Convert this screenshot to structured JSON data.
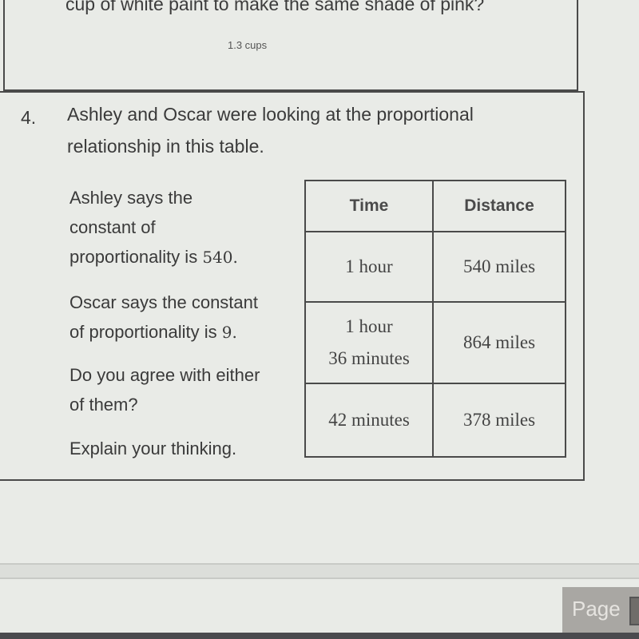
{
  "previous_question": {
    "text_fragment": "cup of white paint to make the same shade of pink?",
    "answer": "1.3 cups"
  },
  "question": {
    "number": "4.",
    "prompt_line1": "Ashley and Oscar were looking at the proportional",
    "prompt_line2": "relationship in this table.",
    "ashley_line1": "Ashley says the",
    "ashley_line2": "constant of",
    "ashley_line3": "proportionality is",
    "ashley_value": "540.",
    "oscar_line1": "Oscar says the constant",
    "oscar_line2": "of proportionality is",
    "oscar_value": "9.",
    "ask_line1": "Do you agree with either",
    "ask_line2": "of them?",
    "explain": "Explain your thinking."
  },
  "table": {
    "headers": [
      "Time",
      "Distance"
    ],
    "rows": [
      {
        "time": [
          "1 hour"
        ],
        "distance": "540 miles"
      },
      {
        "time": [
          "1 hour",
          "36 minutes"
        ],
        "distance": "864 miles"
      },
      {
        "time": [
          "42 minutes"
        ],
        "distance": "378 miles"
      }
    ]
  },
  "footer": {
    "page_button": "Page"
  }
}
